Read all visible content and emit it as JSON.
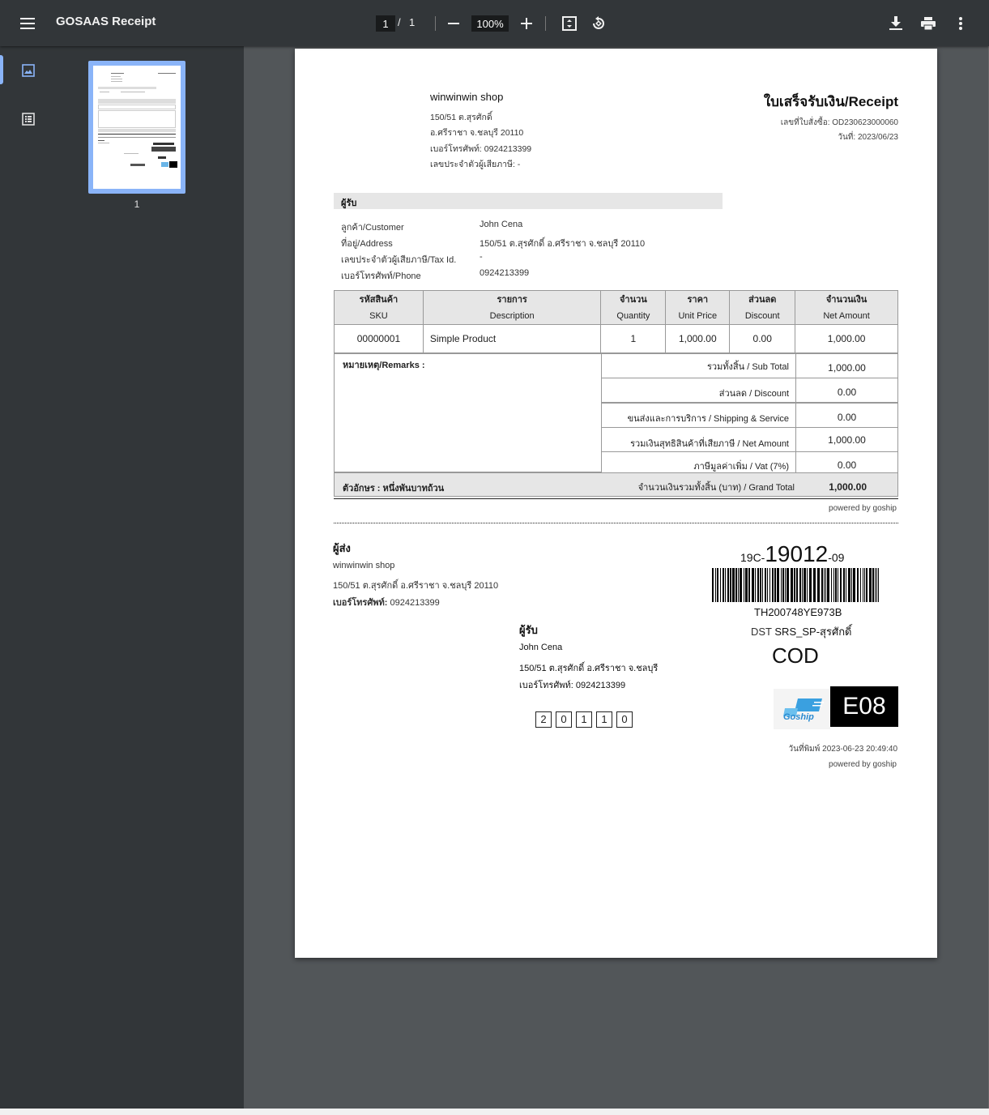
{
  "viewer": {
    "title": "GOSAAS Receipt",
    "page_current": "1",
    "page_sep": "/",
    "page_total": "1",
    "zoom": "100%",
    "thumbnail_label": "1"
  },
  "doc": {
    "shop_name": "winwinwin shop",
    "shop_address1": "150/51 ต.สุรศักดิ์",
    "shop_address2": "อ.ศรีราชา จ.ชลบุรี 20110",
    "shop_phone": "เบอร์โทรศัพท์: 0924213399",
    "shop_tax": "เลขประจำตัวผู้เสียภาษี:  -",
    "title": "ใบเสร็จรับเงิน/Receipt",
    "order_no": "เลขที่ใบสั่งซื้อ: OD230623000060",
    "date": "วันที่: 2023/06/23",
    "recipient_band": "ผู้รับ",
    "info_labels": [
      "ลูกค้า/Customer",
      "ที่อยู่/Address",
      "เลขประจำตัวผู้เสียภาษี/Tax Id.",
      "เบอร์โทรศัพท์/Phone"
    ],
    "info_values": [
      "John Cena",
      "150/51 ต.สุรศักดิ์ อ.ศรีราชา จ.ชลบุรี 20110",
      "-",
      "0924213399"
    ],
    "columns": [
      {
        "th": "รหัสสินค้า",
        "en": "SKU"
      },
      {
        "th": "รายการ",
        "en": "Description"
      },
      {
        "th": "จำนวน",
        "en": "Quantity"
      },
      {
        "th": "ราคา",
        "en": "Unit Price"
      },
      {
        "th": "ส่วนลด",
        "en": "Discount"
      },
      {
        "th": "จำนวนเงิน",
        "en": "Net Amount"
      }
    ],
    "row": {
      "sku": "00000001",
      "desc": "Simple Product",
      "qty": "1",
      "price": "1,000.00",
      "discount": "0.00",
      "net": "1,000.00"
    },
    "remarks": "หมายเหตุ/Remarks :",
    "summary": [
      {
        "label": "รวมทั้งสิ้น / Sub Total",
        "value": "1,000.00"
      },
      {
        "label": "ส่วนลด / Discount",
        "value": "0.00"
      },
      {
        "label": "ขนส่งและการบริการ / Shipping & Service",
        "value": "0.00"
      },
      {
        "label": "รวมเงินสุทธิสินค้าที่เสียภาษี / Net Amount",
        "value": "1,000.00"
      },
      {
        "label": "ภาษีมูลค่าเพิ่ม / Vat (7%)",
        "value": "0.00"
      }
    ],
    "words": "ตัวอักษร : หนึ่งพันบาทถ้วน",
    "grand_label": "จำนวนเงินรวมทั้งสิ้น (บาท) / Grand Total",
    "grand_value": "1,000.00",
    "powered": "powered by goship"
  },
  "label": {
    "sender_h": "ผู้ส่ง",
    "sender_name": "winwinwin shop",
    "sender_address": "150/51 ต.สุรศักดิ์ อ.ศรีราชา จ.ชลบุรี 20110",
    "sender_phone_label": "เบอร์โทรศัพท์:",
    "sender_phone": "0924213399",
    "recv_h": "ผู้รับ",
    "recv_name": "John Cena",
    "recv_address": "150/51 ต.สุรศักดิ์ อ.ศรีราชา จ.ชลบุรี",
    "recv_phone": "เบอร์โทรศัพท์: 0924213399",
    "zip": [
      "2",
      "0",
      "1",
      "1",
      "0"
    ],
    "route_prefix": "19C-",
    "route_main": "19012",
    "route_suffix": "-09",
    "tracking": "TH200748YE973B",
    "dst_label": "DST",
    "dst_value": "SRS_SP-สุรศักดิ์",
    "cod": "COD",
    "logo_text": "Goship",
    "sort_code": "E08",
    "printed": "วันที่พิมพ์ 2023-06-23 20:49:40",
    "powered": "powered by goship"
  }
}
